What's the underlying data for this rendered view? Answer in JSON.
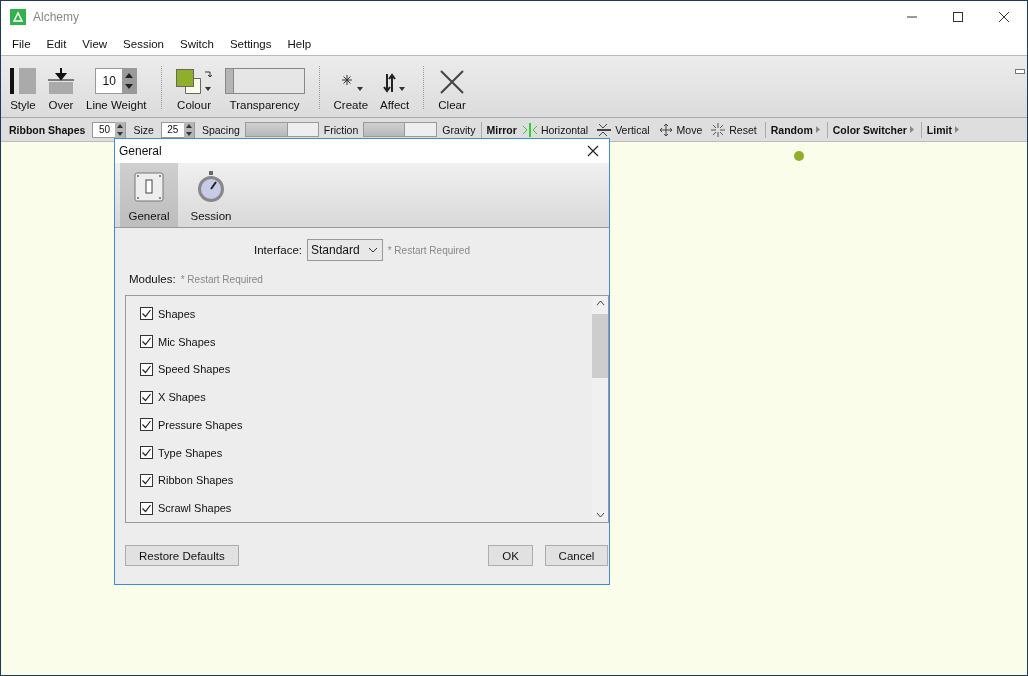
{
  "window": {
    "title": "Alchemy"
  },
  "menu": [
    "File",
    "Edit",
    "View",
    "Session",
    "Switch",
    "Settings",
    "Help"
  ],
  "toolbar": [
    {
      "kind": "style",
      "label": "Style"
    },
    {
      "kind": "over",
      "label": "Over"
    },
    {
      "kind": "spinner",
      "label": "Line Weight",
      "value": "10"
    },
    {
      "kind": "separator"
    },
    {
      "kind": "colour",
      "label": "Colour",
      "color": "#8fae2a"
    },
    {
      "kind": "slider",
      "label": "Transparency",
      "level": 0.1
    },
    {
      "kind": "separator"
    },
    {
      "kind": "create",
      "label": "Create"
    },
    {
      "kind": "affect",
      "label": "Affect"
    },
    {
      "kind": "separator"
    },
    {
      "kind": "clear",
      "label": "Clear"
    }
  ],
  "ribbon_bar": [
    {
      "kind": "title",
      "text": "Ribbon Shapes"
    },
    {
      "kind": "spinner",
      "value": "50"
    },
    {
      "kind": "label",
      "text": "Size"
    },
    {
      "kind": "spinner",
      "value": "25"
    },
    {
      "kind": "label",
      "text": "Spacing"
    },
    {
      "kind": "slider",
      "level": 0.57
    },
    {
      "kind": "label",
      "text": "Friction"
    },
    {
      "kind": "slider",
      "level": 0.55
    },
    {
      "kind": "label",
      "text": "Gravity"
    },
    {
      "kind": "separator"
    },
    {
      "kind": "title",
      "text": "Mirror"
    },
    {
      "kind": "horizontal",
      "text": "Horizontal"
    },
    {
      "kind": "vertical",
      "text": "Vertical"
    },
    {
      "kind": "move",
      "text": "Move"
    },
    {
      "kind": "reset",
      "text": "Reset"
    },
    {
      "kind": "separator"
    },
    {
      "kind": "menu",
      "text": "Random"
    },
    {
      "kind": "separator"
    },
    {
      "kind": "menu",
      "text": "Color Switcher"
    },
    {
      "kind": "separator"
    },
    {
      "kind": "menu",
      "text": "Limit"
    }
  ],
  "dialog": {
    "title": "General",
    "tabs": [
      {
        "kind": "general",
        "label": "General",
        "selected": true
      },
      {
        "kind": "session",
        "label": "Session",
        "selected": false
      }
    ],
    "interface": {
      "label": "Interface:",
      "value": "Standard",
      "note": "* Restart Required"
    },
    "modules": {
      "label": "Modules:",
      "note": "* Restart Required",
      "items": [
        {
          "label": "Shapes",
          "checked": true
        },
        {
          "label": "Mic Shapes",
          "checked": true
        },
        {
          "label": "Speed Shapes",
          "checked": true
        },
        {
          "label": "X Shapes",
          "checked": true
        },
        {
          "label": "Pressure Shapes",
          "checked": true
        },
        {
          "label": "Type Shapes",
          "checked": true
        },
        {
          "label": "Ribbon Shapes",
          "checked": true
        },
        {
          "label": "Scrawl Shapes",
          "checked": true
        }
      ]
    },
    "buttons": {
      "restore": "Restore Defaults",
      "ok": "OK",
      "cancel": "Cancel"
    }
  }
}
